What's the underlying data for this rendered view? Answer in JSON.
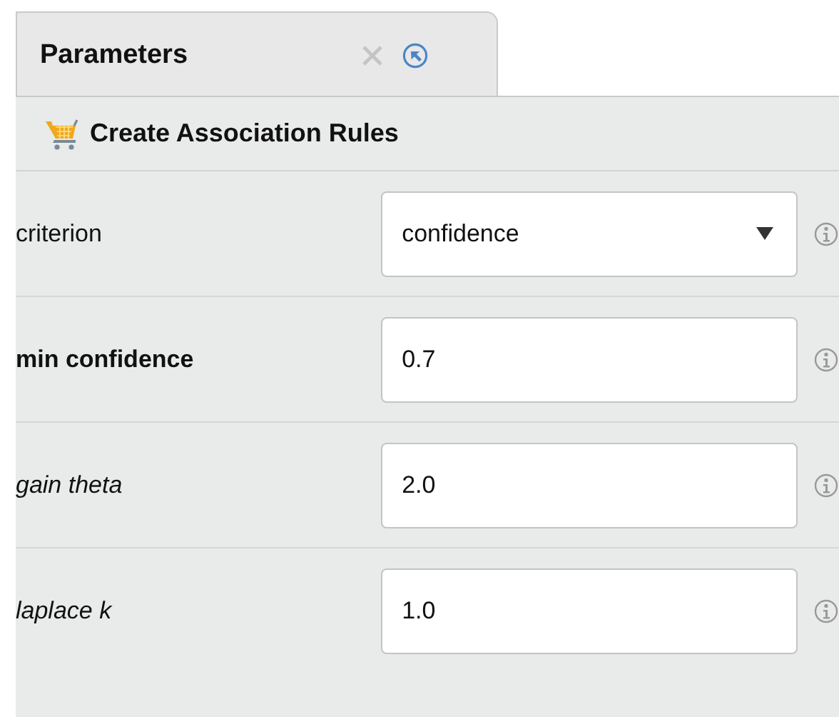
{
  "tabs": [
    {
      "label": "Parameters",
      "selected": true
    }
  ],
  "operator": {
    "title": "Create Association Rules"
  },
  "parameters": [
    {
      "label": "criterion",
      "bold": false,
      "italic": false,
      "kind": "dropdown",
      "value": "confidence"
    },
    {
      "label": "min confidence",
      "bold": true,
      "italic": false,
      "kind": "text",
      "value": "0.7"
    },
    {
      "label": "gain theta",
      "bold": false,
      "italic": true,
      "kind": "text",
      "value": "2.0"
    },
    {
      "label": "laplace k",
      "bold": false,
      "italic": true,
      "kind": "text",
      "value": "1.0"
    }
  ]
}
